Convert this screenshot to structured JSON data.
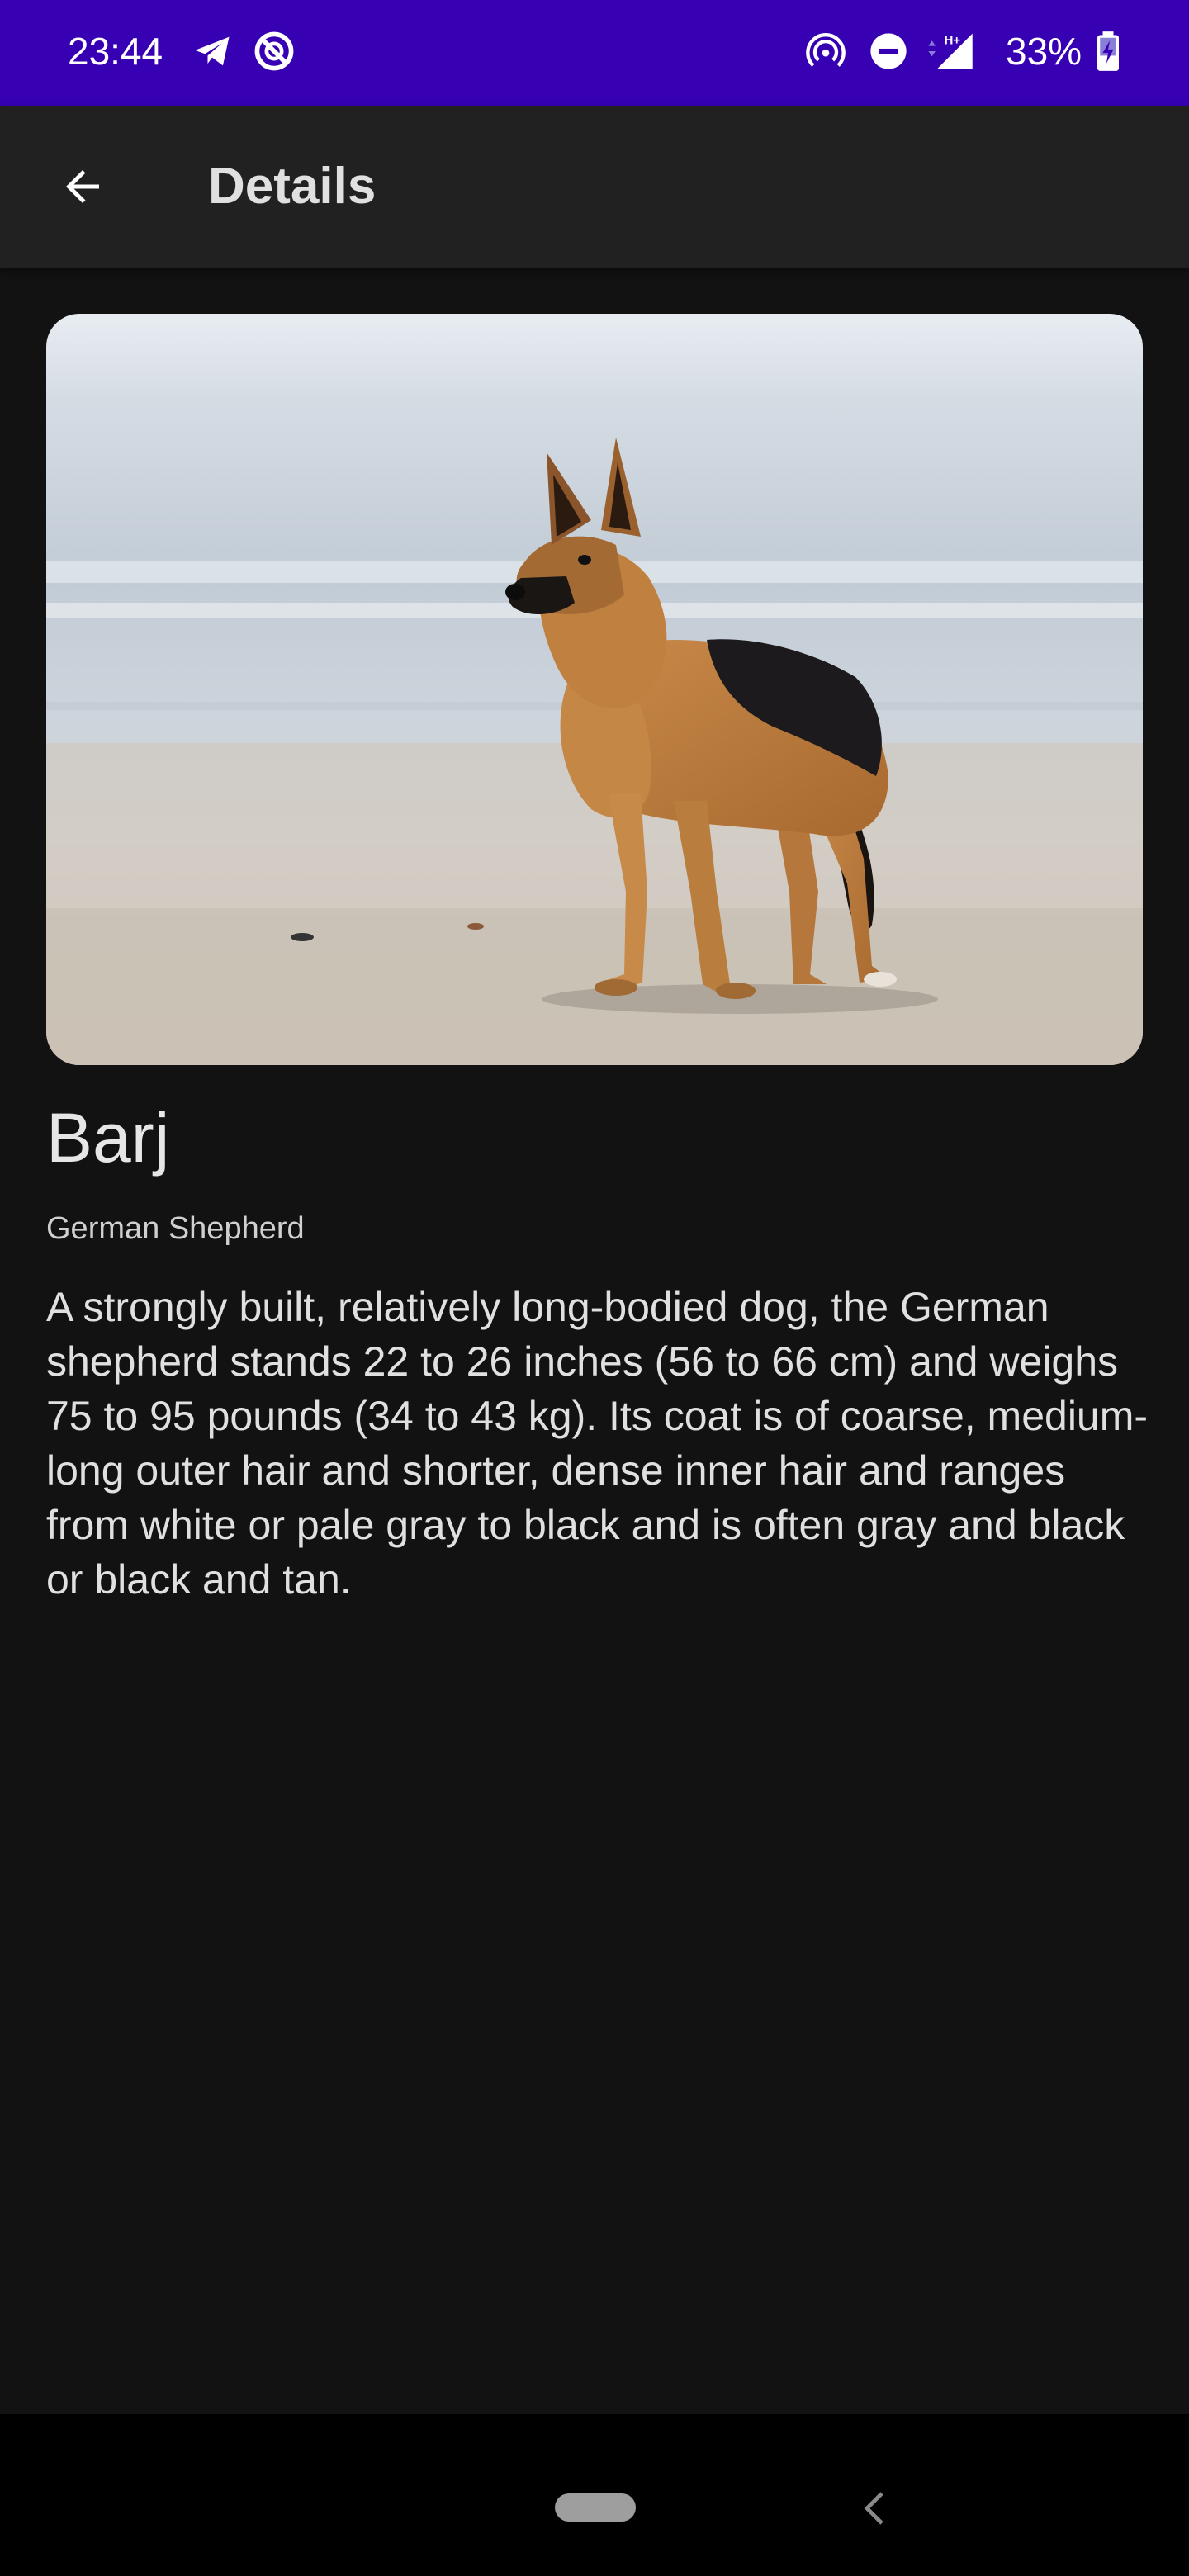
{
  "status_bar": {
    "time": "23:44",
    "battery": "33%",
    "left_icons": [
      "telegram-icon",
      "do-not-disturb-app-icon"
    ],
    "right_icons": [
      "hotspot-icon",
      "dnd-icon",
      "signal-hplus-icon",
      "battery-charging-icon"
    ],
    "color": "#3700b3"
  },
  "app_bar": {
    "title": "Details",
    "back_icon": "arrow-back-icon",
    "color": "#212121"
  },
  "pet": {
    "photo_alt": "dog-photo",
    "name": "Barj",
    "breed": "German Shepherd",
    "description": "A strongly built, relatively long-bodied dog, the German shepherd stands 22 to 26 inches (56 to 66 cm) and weighs 75 to 95 pounds (34 to 43 kg). Its coat is of coarse, medium-long outer hair and shorter, dense inner hair and ranges from white or pale gray to black and is often gray and black or black and tan."
  },
  "nav_bar": {
    "home_icon": "home-pill-icon",
    "back_icon": "nav-back-icon"
  },
  "colors": {
    "background": "#121212",
    "text_primary": "#e0e0e0"
  }
}
